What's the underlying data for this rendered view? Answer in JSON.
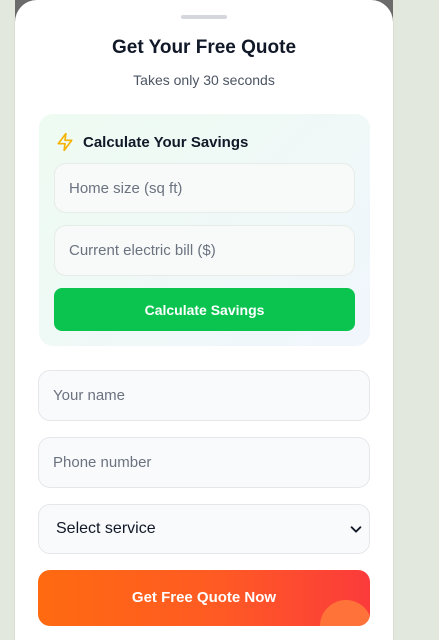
{
  "header": {
    "title": "Get Your Free Quote",
    "subtitle": "Takes only 30 seconds"
  },
  "calculator": {
    "icon": "lightning-bolt-icon",
    "title": "Calculate Your Savings",
    "home_size_placeholder": "Home size (sq ft)",
    "electric_bill_placeholder": "Current electric bill ($)",
    "button_label": "Calculate Savings"
  },
  "form": {
    "name_placeholder": "Your name",
    "phone_placeholder": "Phone number",
    "service_selected": "Select service",
    "submit_label": "Get Free Quote Now"
  },
  "colors": {
    "accent_green": "#0bc44f",
    "cta_orange": "#ff6a10",
    "cta_red": "#fb3b3b",
    "bolt_yellow": "#f5b301"
  }
}
